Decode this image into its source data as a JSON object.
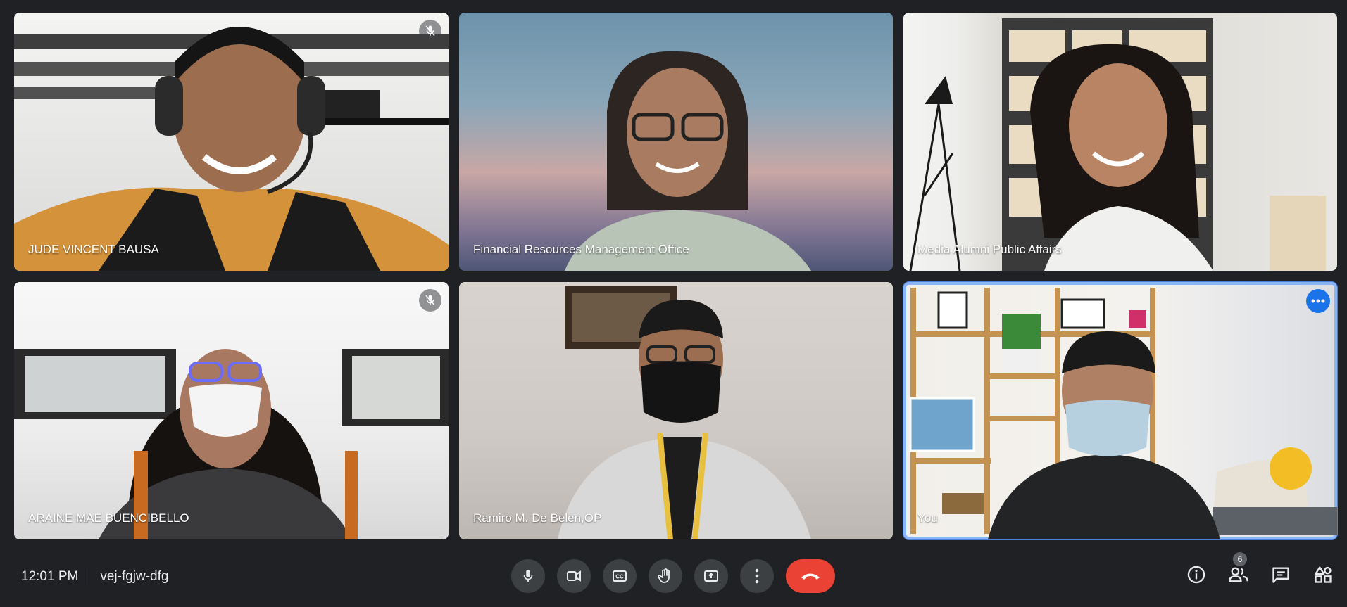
{
  "participants": [
    {
      "name": "JUDE VINCENT BAUSA",
      "muted": true
    },
    {
      "name": "Financial Resources Management Office",
      "muted": false
    },
    {
      "name": "Media Alumni Public Affairs",
      "muted": false
    },
    {
      "name": "ARAINE MAE BUENCIBELLO",
      "muted": true
    },
    {
      "name": "Ramiro M. De Belen,OP",
      "muted": false
    },
    {
      "name": "You",
      "muted": false,
      "active": true
    }
  ],
  "bottom_bar": {
    "time": "12:01 PM",
    "meeting_code": "vej-fgjw-dfg",
    "participant_count": "6"
  },
  "icons": {
    "mic": "microphone-icon",
    "camera": "videocam-icon",
    "captions": "closed-captions-icon",
    "raise_hand": "raise-hand-icon",
    "present": "present-screen-icon",
    "more": "more-vert-icon",
    "end_call": "end-call-icon",
    "info": "info-icon",
    "people": "people-icon",
    "chat": "chat-icon",
    "activities": "activities-icon"
  },
  "colors": {
    "background": "#202124",
    "control": "#3c4043",
    "end_call": "#ea4335",
    "active_border": "#8ab4f8",
    "more_button": "#1a73e8"
  }
}
